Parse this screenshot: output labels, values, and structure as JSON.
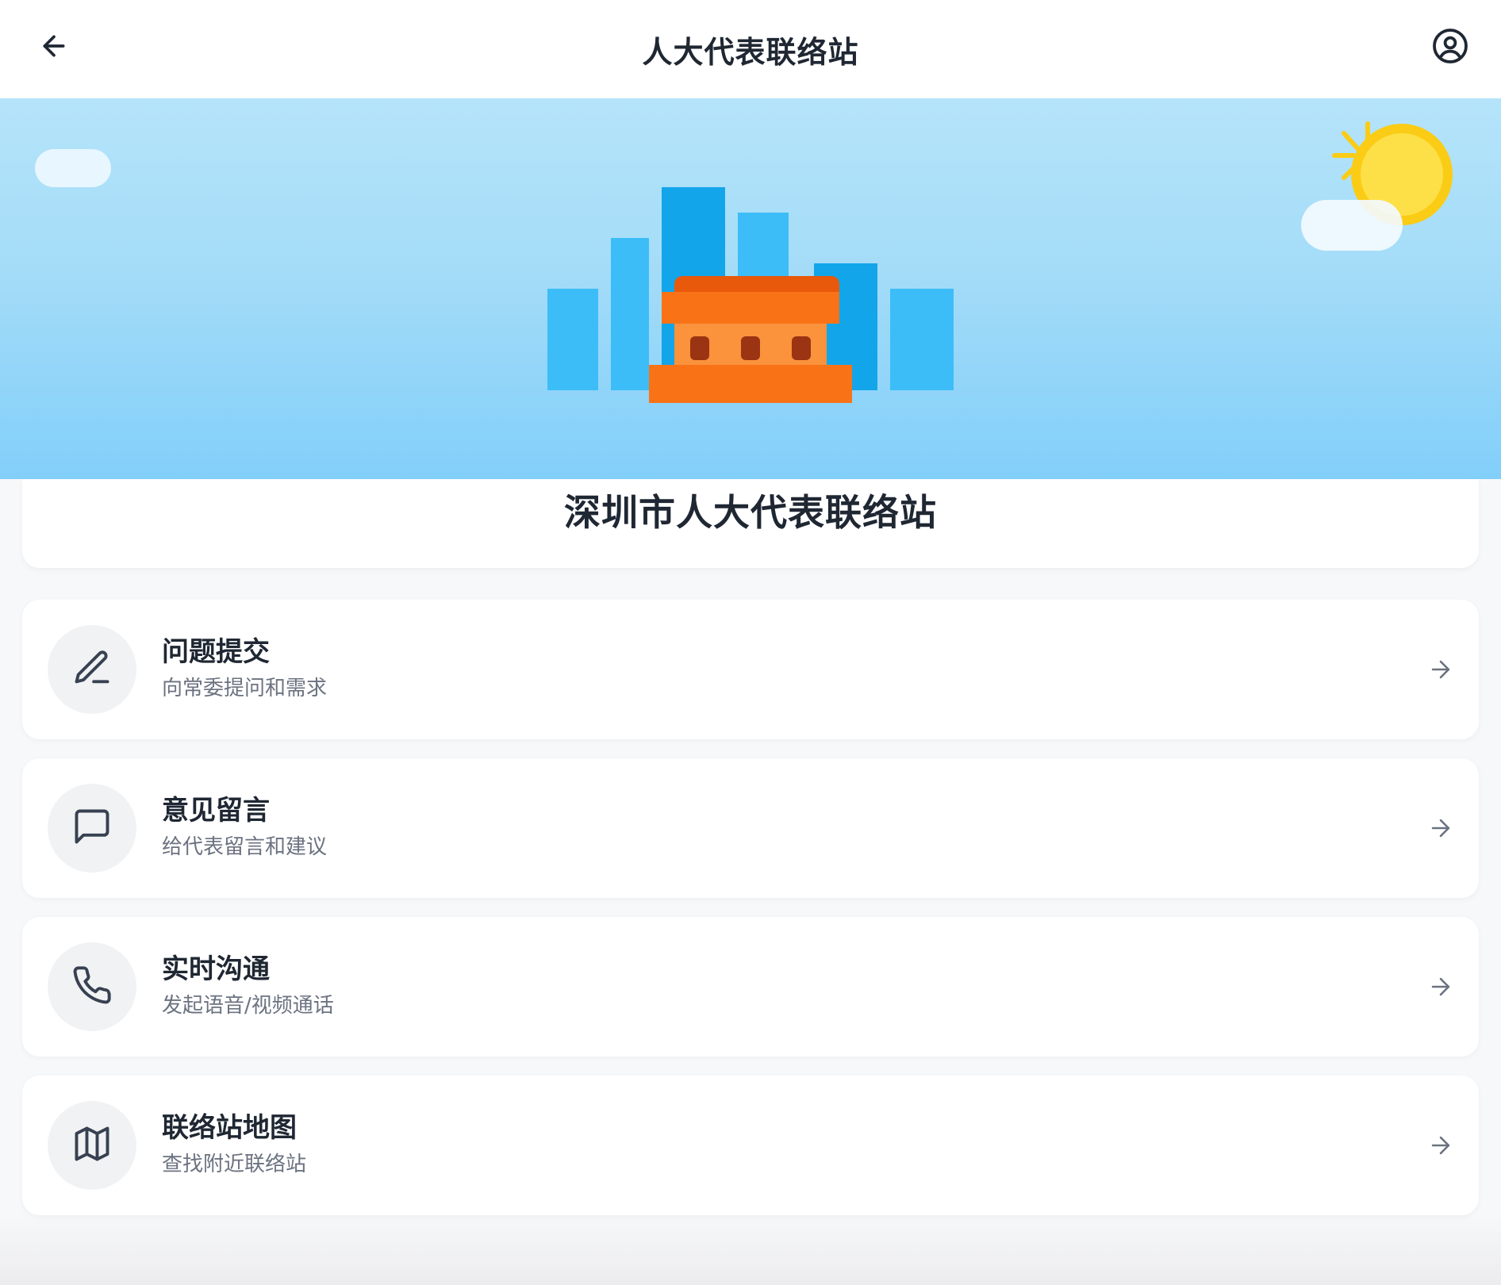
{
  "header": {
    "title": "人大代表联络站",
    "back_icon": "arrow-left-icon",
    "profile_icon": "user-circle-icon"
  },
  "banner": {
    "illustration": "city-skyline-with-orange-station-building",
    "colors": {
      "sky_top": "#b5e4fa",
      "sky_bottom": "#82cffa",
      "building_blue_light": "#3cbdf8",
      "building_blue_dark": "#12a5ea",
      "station_orange": "#f97316",
      "station_roof": "#e8590c",
      "station_wall": "#fb923c",
      "window": "#9a3412",
      "sun": "#fcd34d",
      "sun_ring": "#facc15"
    }
  },
  "station": {
    "name": "深圳市人大代表联络站"
  },
  "menu": [
    {
      "icon": "pencil-icon",
      "title": "问题提交",
      "subtitle": "向常委提问和需求"
    },
    {
      "icon": "message-square-icon",
      "title": "意见留言",
      "subtitle": "给代表留言和建议"
    },
    {
      "icon": "phone-icon",
      "title": "实时沟通",
      "subtitle": "发起语音/视频通话"
    },
    {
      "icon": "map-icon",
      "title": "联络站地图",
      "subtitle": "查找附近联络站"
    }
  ]
}
